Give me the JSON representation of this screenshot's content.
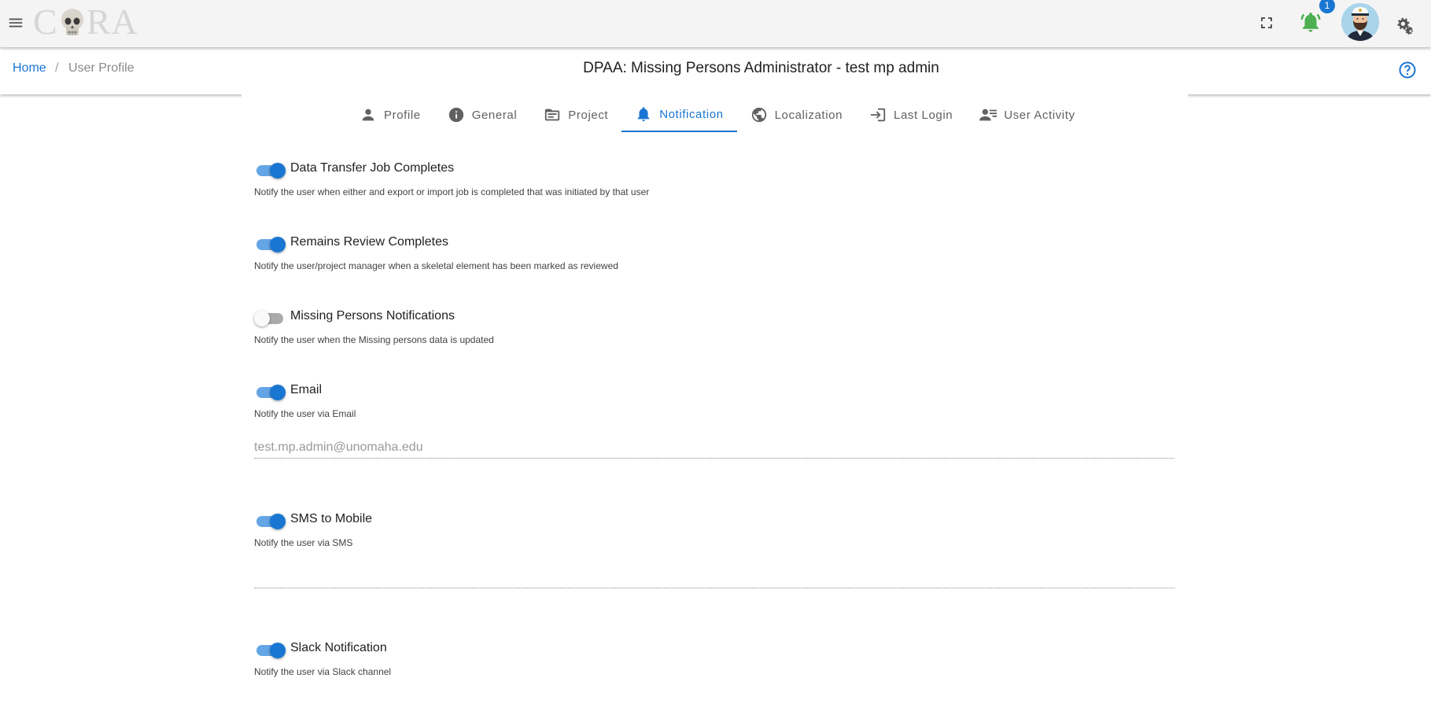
{
  "app": {
    "logo_text_left": "C",
    "logo_text_right": "RA"
  },
  "header": {
    "notification_count": "1"
  },
  "breadcrumb": {
    "home": "Home",
    "separator": "/",
    "current": "User Profile"
  },
  "page": {
    "title": "DPAA: Missing Persons Administrator - test mp admin"
  },
  "tabs": [
    {
      "label": "Profile",
      "icon": "person-icon"
    },
    {
      "label": "General",
      "icon": "info-icon"
    },
    {
      "label": "Project",
      "icon": "project-icon"
    },
    {
      "label": "Notification",
      "icon": "bell-icon",
      "active": true
    },
    {
      "label": "Localization",
      "icon": "globe-icon"
    },
    {
      "label": "Last Login",
      "icon": "login-icon"
    },
    {
      "label": "User Activity",
      "icon": "user-activity-icon"
    }
  ],
  "settings": [
    {
      "label": "Data Transfer Job Completes",
      "description": "Notify the user when either and export or import job is completed that was initiated by that user",
      "enabled": true
    },
    {
      "label": "Remains Review Completes",
      "description": "Notify the user/project manager when a skeletal element has been marked as reviewed",
      "enabled": true
    },
    {
      "label": "Missing Persons Notifications",
      "description": "Notify the user when the Missing persons data is updated",
      "enabled": false
    },
    {
      "label": "Email",
      "description": "Notify the user via Email",
      "enabled": true,
      "value": "test.mp.admin@unomaha.edu"
    },
    {
      "label": "SMS to Mobile",
      "description": "Notify the user via SMS",
      "enabled": true,
      "value": ""
    },
    {
      "label": "Slack Notification",
      "description": "Notify the user via Slack channel",
      "enabled": true
    }
  ],
  "colors": {
    "primary": "#1976d2",
    "bell": "#4caf50",
    "appbar": "#f4f4f4"
  }
}
